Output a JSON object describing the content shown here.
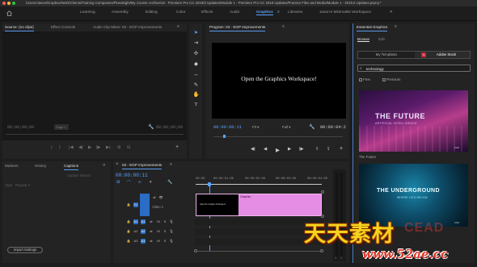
{
  "titlebar": {
    "path": "/Users/Jason/Dropbox/Work/Clients/Training Companies/Pluralsight/My Course Archive/15 - Premiere Pro CC 2019/3 Updates/Module 1 - Premiere Pro CC 2019 Updates/Practice Files and Media/Module 1 - 2019.0 Updates.prproj *"
  },
  "workspaces": [
    {
      "label": "Learning"
    },
    {
      "label": "Assembly"
    },
    {
      "label": "Editing"
    },
    {
      "label": "Color"
    },
    {
      "label": "Effects"
    },
    {
      "label": "Audio"
    },
    {
      "label": "Graphics"
    },
    {
      "label": "Libraries"
    },
    {
      "label": "Jason's Minimalist Workspace"
    }
  ],
  "workspace_overflow": "»",
  "source_panel": {
    "tabs": [
      "Source: (no clips)",
      "Effect Controls",
      "Audio Clip Mixer: 03 - EGP Improvements"
    ],
    "menu": "≡",
    "timecode_left": "00;00;00;00",
    "page_label": "Page 1",
    "timecode_right": "00;00;00;00"
  },
  "program_monitor": {
    "title": "Program: 03 - EGP Improvements",
    "menu": "≡",
    "video_text": "Open the Graphics Workspace!",
    "timecode": "00:00:00:11",
    "fit": "Fit",
    "quality": "Full",
    "duration": "00:00:04:2"
  },
  "captions_panel": {
    "tabs": [
      "Markers",
      "History",
      "Captions"
    ],
    "overflow": "»",
    "stream_label": "Caption Stream",
    "style_label": "Style:",
    "style_value": "Regular",
    "import_button": "Import Settings"
  },
  "timeline": {
    "close": "×",
    "title": "03 - EGP Improvements",
    "menu": "≡",
    "timecode": "00:00:00:11",
    "ruler": [
      "00:00",
      "00:00:01:00",
      "00:00:02:00",
      "00:00:03:00",
      "00:00:04:00"
    ],
    "video_track_label": "Video 1",
    "tracks": [
      "V1",
      "A1",
      "A2",
      "A3"
    ],
    "clip_label": "Graphic",
    "clip_thumb_text": "Open the Graphics Workspace!"
  },
  "essential_graphics": {
    "title": "Essential Graphics",
    "menu": "≡",
    "tabs": [
      "Browse",
      "Edit"
    ],
    "subtabs": [
      "My Templates",
      "Adobe Stock"
    ],
    "search_value": "technology",
    "filters": [
      "Free",
      "Premium"
    ],
    "templates": [
      {
        "title": "THE FUTURE",
        "subtitle": "ARTIFICIAL INTELLIGENCE",
        "caption": "The Future",
        "code": "2:00"
      },
      {
        "title": "THE UNDERGROUND",
        "subtitle": "WHERE LIES BELOW",
        "caption": "",
        "code": "2:00"
      }
    ]
  },
  "watermark": {
    "chinese": "天天素材",
    "url": "www.52ae.cc",
    "badge": "CEAD"
  },
  "colors": {
    "accent": "#5aa2ff",
    "clip_pink": "#e58ce4",
    "stock_red": "#c4263a",
    "track_blue": "#2b6cc4"
  }
}
